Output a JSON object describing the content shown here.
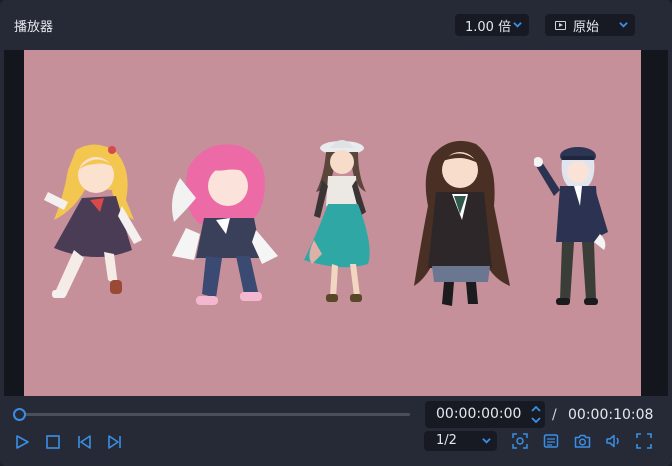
{
  "app": {
    "title": "播放器"
  },
  "header": {
    "speed_label": "1.00 倍",
    "ratio_label": "原始"
  },
  "video": {
    "current_time": "00:00:00:00",
    "separator": "/",
    "total_time": "00:00:10:08",
    "progress_fraction": 0.0,
    "page_label": "1/2"
  },
  "icons": {
    "play": "play-icon",
    "stop": "stop-icon",
    "prev": "skip-back-icon",
    "next": "skip-forward-icon",
    "focus": "focus-icon",
    "subtitle": "subtitle-icon",
    "camera": "camera-icon",
    "volume": "volume-icon",
    "fullscreen": "fullscreen-icon"
  },
  "colors": {
    "accent": "#3a8ee6",
    "frame_background": "#c5909a"
  }
}
